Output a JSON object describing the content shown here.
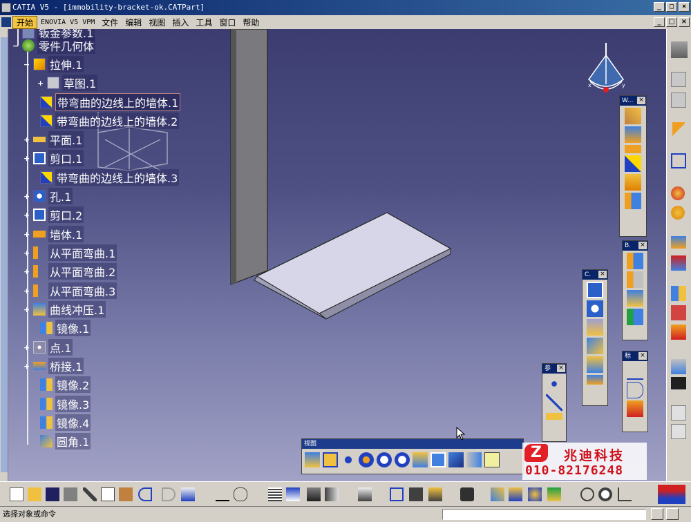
{
  "window": {
    "title": "CATIA V5 - [immobility-bracket-ok.CATPart]",
    "min": "_",
    "restore": "□",
    "close": "×"
  },
  "menu": [
    {
      "label": "开始",
      "active": true
    },
    {
      "label": "ENOVIA V5 VPM",
      "small": true
    },
    {
      "label": "文件"
    },
    {
      "label": "编辑"
    },
    {
      "label": "视图"
    },
    {
      "label": "插入"
    },
    {
      "label": "工具"
    },
    {
      "label": "窗口"
    },
    {
      "label": "帮助"
    }
  ],
  "tree": {
    "partial_top": "钣金参数.1",
    "root": "零件几何体",
    "items": [
      "拉伸.1",
      "草图.1",
      "带弯曲的边线上的墙体.1",
      "带弯曲的边线上的墙体.2",
      "平面.1",
      "剪口.1",
      "带弯曲的边线上的墙体.3",
      "孔.1",
      "剪口.2",
      "墙体.1",
      "从平面弯曲.1",
      "从平面弯曲.2",
      "从平面弯曲.3",
      "曲线冲压.1",
      "镜像.1",
      "点.1",
      "桥接.1",
      "镜像.2",
      "镜像.3",
      "镜像.4",
      "圆角.1"
    ]
  },
  "toolbars": {
    "walls": {
      "title": "W..."
    },
    "bending": {
      "title": "B."
    },
    "cutting": {
      "title": "C."
    },
    "reference": {
      "title": "参"
    },
    "annotation": {
      "title": "标"
    },
    "view": {
      "title": "视图"
    },
    "close_glyph": "×"
  },
  "compass": {
    "x": "x",
    "y": "y"
  },
  "logo": {
    "mark": "Z",
    "company": "兆迪科技",
    "phone": "010-82176248"
  },
  "status": {
    "prompt": "选择对象或命令"
  },
  "colors": {
    "viewport_top": "#3c3c70",
    "viewport_bottom": "#a2a2c6",
    "titlebar": "#0a246a",
    "accent_red": "#d0101a"
  }
}
